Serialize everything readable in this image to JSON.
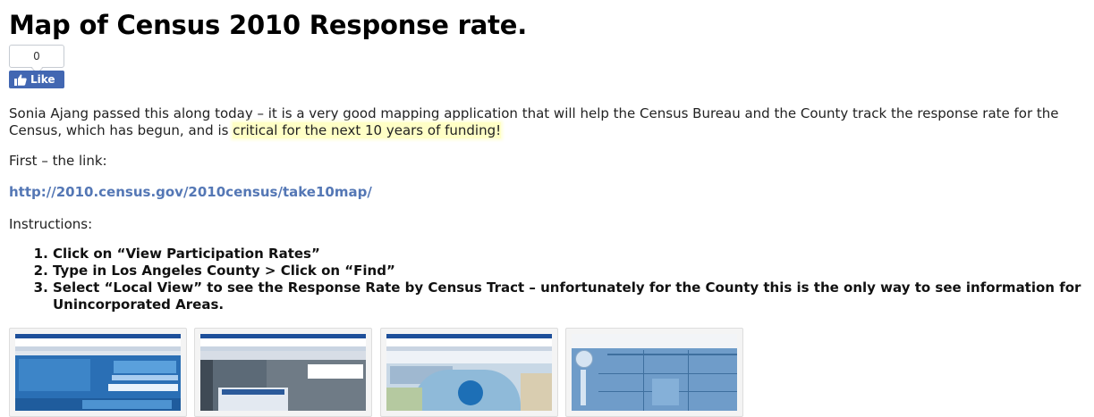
{
  "title": "Map of Census 2010 Response rate.",
  "like_widget": {
    "count": "0",
    "label": "Like",
    "icon": "thumbs-up-icon",
    "color": "#4267b2"
  },
  "paragraph_1": {
    "text_before": "Sonia Ajang passed this along today – it is a very good mapping application that will help the Census Bureau and the County track the response rate for the Census, which has begun, and is ",
    "highlight": "critical for the next 10 years of funding!"
  },
  "paragraph_2": "First – the link:",
  "link": {
    "text": "http://2010.census.gov/2010census/take10map/",
    "color": "#5477b5"
  },
  "paragraph_3": "Instructions:",
  "instructions": [
    "Click on “View Participation Rates”",
    "Type in Los Angeles County > Click on “Find”",
    "Select “Local View” to see the Response Rate by Census Tract – unfortunately for the County this is the only way to see information for Unincorporated Areas."
  ],
  "thumbnails": [
    {
      "name": "screenshot-thumbnail-1"
    },
    {
      "name": "screenshot-thumbnail-2"
    },
    {
      "name": "screenshot-thumbnail-3"
    },
    {
      "name": "screenshot-thumbnail-4"
    }
  ],
  "highlight_color": "#ffffc6"
}
